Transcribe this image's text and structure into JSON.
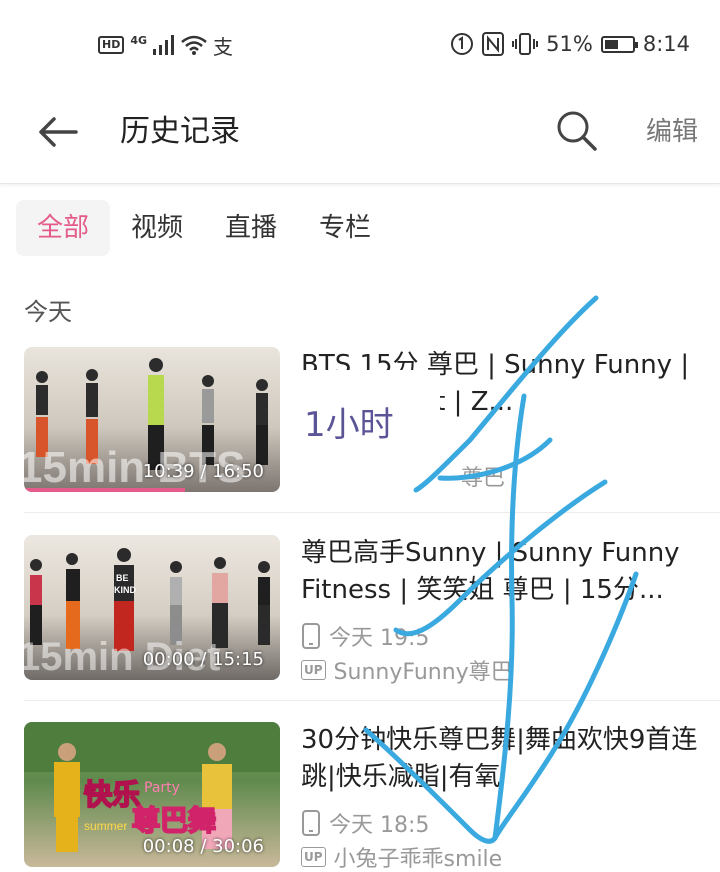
{
  "status_bar": {
    "hd": "HD",
    "net": "4G",
    "wifi_icon": "wifi-icon",
    "pay_icon": "支",
    "battery_pct": "51%",
    "battery_level": 0.51,
    "time": "8:14"
  },
  "header": {
    "title": "历史记录",
    "edit": "编辑"
  },
  "tabs": [
    "全部",
    "视频",
    "直播",
    "专栏"
  ],
  "section_today": "今天",
  "items": [
    {
      "title": "BTS 15分 尊巴 | Sunny Funny | Dance Diet | Z...",
      "duration": "10:39 / 16:50",
      "progress": 0.63,
      "author": "尊巴"
    },
    {
      "title": "尊巴高手Sunny | Sunny Funny Fitness | 笑笑姐 尊巴 | 15分...",
      "duration": "00:00 / 15:15",
      "time": "今天 19:5",
      "author": "SunnyFunny尊巴"
    },
    {
      "title": "30分钟快乐尊巴舞|舞曲欢快9首连跳|快乐减脂|有氧",
      "duration": "00:08 / 30:06",
      "time": "今天 18:5",
      "author": "小兔子乖乖smile"
    }
  ],
  "overlay_text": "1小时",
  "colors": {
    "accent": "#e35a8b",
    "scribble": "#3aa9e0",
    "overlay_text": "#5b5597"
  }
}
